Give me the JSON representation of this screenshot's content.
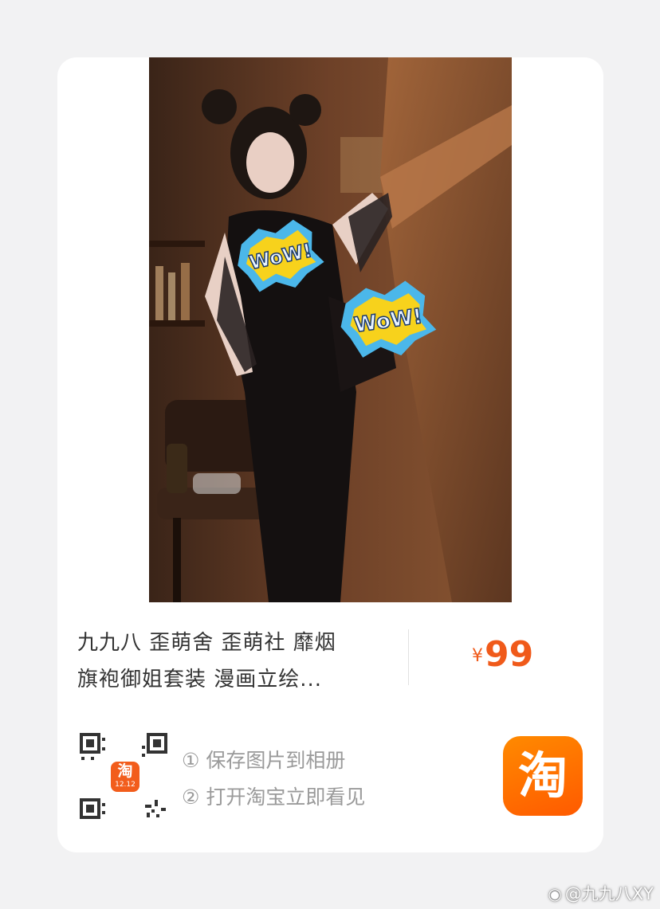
{
  "product": {
    "photo_icon": "product-photo",
    "badge_left_text": "WoW!",
    "badge_right_text": "WoW!",
    "title_line1": "九九八 歪萌舍 歪萌社 靡烟",
    "title_line2": "旗袍御姐套装 漫画立绘...",
    "price_symbol": "¥",
    "price_value": "99",
    "price_color": "#f05a1a"
  },
  "share": {
    "qr_badge_char": "淘",
    "qr_badge_sub": "12.12",
    "step1": "① 保存图片到相册",
    "step2": "② 打开淘宝立即看见",
    "app_icon_char": "淘",
    "app_icon_color": "#ff6a00"
  },
  "watermark": {
    "icon": "weibo-icon",
    "text": "@九九八XY"
  }
}
